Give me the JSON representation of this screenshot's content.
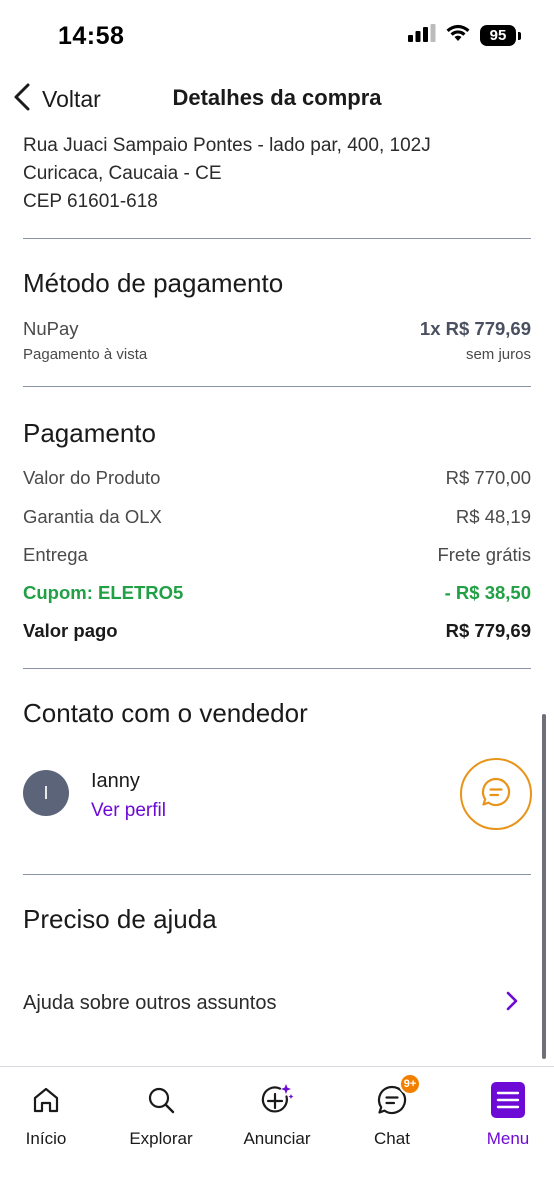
{
  "status_bar": {
    "time": "14:58",
    "battery": "95"
  },
  "header": {
    "back_label": "Voltar",
    "title": "Detalhes da compra"
  },
  "address": {
    "line1": "Rua Juaci Sampaio Pontes - lado par, 400, 102J",
    "line2": "Curicaca, Caucaia - CE",
    "line3": "CEP 61601-618"
  },
  "payment_method": {
    "title": "Método de pagamento",
    "method": "NuPay",
    "method_sub": "Pagamento à vista",
    "amount": "1x R$ 779,69",
    "interest": "sem juros"
  },
  "payment": {
    "title": "Pagamento",
    "rows": [
      {
        "label": "Valor do Produto",
        "value": "R$ 770,00"
      },
      {
        "label": "Garantia da OLX",
        "value": "R$ 48,19"
      },
      {
        "label": "Entrega",
        "value": "Frete grátis"
      },
      {
        "label": "Cupom: ELETRO5",
        "value": "- R$ 38,50"
      },
      {
        "label": "Valor pago",
        "value": "R$ 779,69"
      }
    ],
    "coupon_color": "#22a045"
  },
  "seller": {
    "title": "Contato com o vendedor",
    "avatar_initial": "I",
    "name": "Ianny",
    "profile_link": "Ver perfil",
    "chat_icon": "chat-bubble-icon"
  },
  "help": {
    "title": "Preciso de ajuda",
    "item_label": "Ajuda sobre outros assuntos"
  },
  "tabbar": {
    "tabs": [
      {
        "label": "Início",
        "icon": "home-icon"
      },
      {
        "label": "Explorar",
        "icon": "search-icon"
      },
      {
        "label": "Anunciar",
        "icon": "add-sparkle-icon"
      },
      {
        "label": "Chat",
        "icon": "chat-icon",
        "badge": "9+"
      },
      {
        "label": "Menu",
        "icon": "menu-icon",
        "active": true
      }
    ]
  },
  "colors": {
    "brand_purple": "#6e0ad6",
    "accent_orange": "#f28000",
    "success_green": "#22a045"
  }
}
